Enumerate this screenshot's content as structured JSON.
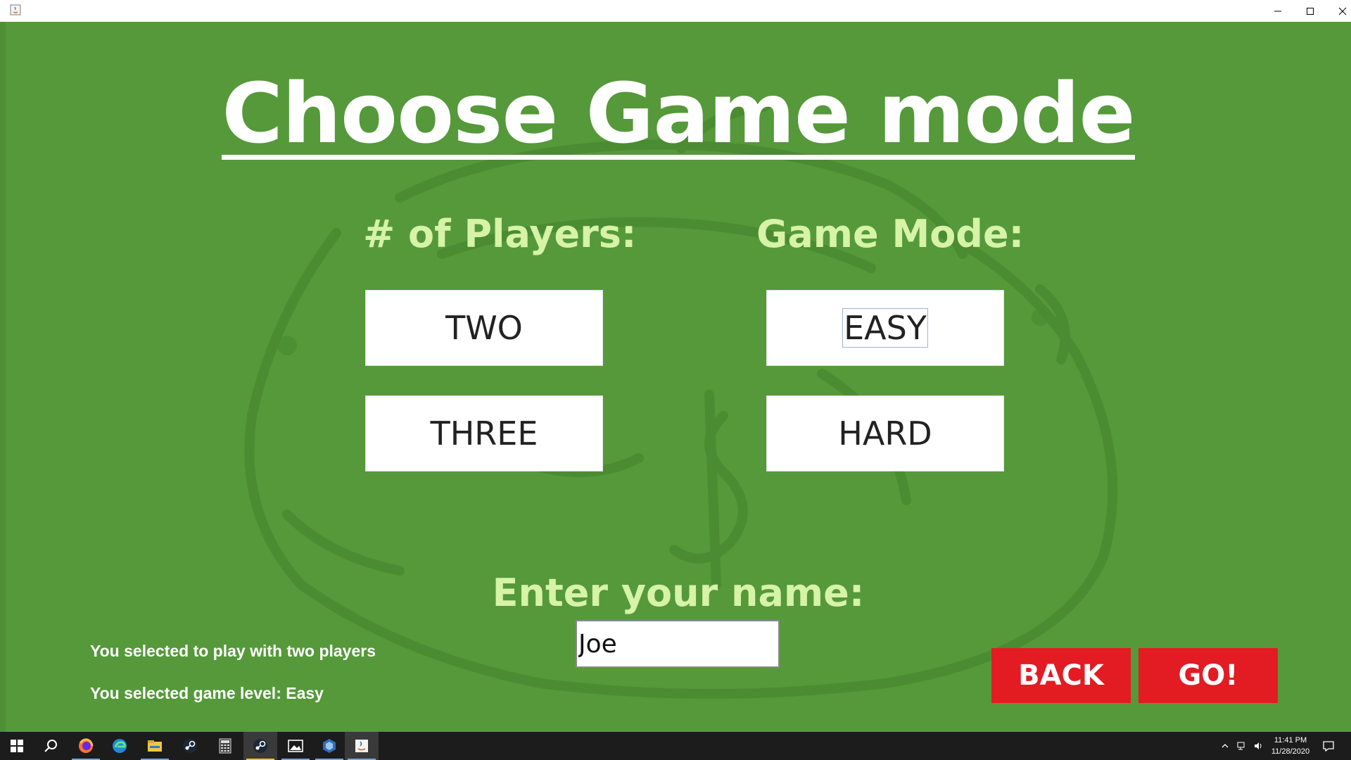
{
  "window": {
    "title": "",
    "controls": [
      "minimize-icon",
      "maximize-icon",
      "close-icon"
    ]
  },
  "screen": {
    "title": "Choose Game mode",
    "players_heading": "# of Players:",
    "mode_heading": "Game Mode:",
    "players_options": [
      {
        "label": "TWO"
      },
      {
        "label": "THREE"
      }
    ],
    "mode_options": [
      {
        "label": "EASY",
        "focused": true
      },
      {
        "label": "HARD"
      }
    ],
    "name_heading": "Enter your name:",
    "name_input": {
      "value": "Joe"
    },
    "status_players": "You selected to play with two players",
    "status_level": "You selected game level: Easy",
    "back_label": "BACK",
    "go_label": "GO!"
  },
  "taskbar": {
    "items": [
      "windows-start-icon",
      "search-icon",
      "firefox-icon",
      "edge-icon",
      "file-explorer-icon",
      "steam-icon",
      "calculator-icon",
      "steam-active-icon",
      "photos-icon",
      "virtualbox-icon",
      "java-app-icon"
    ],
    "time": "11:41 PM",
    "date": "11/28/2020"
  },
  "colors": {
    "background": "#55993a",
    "heading": "#d6f3a7",
    "action_button": "#e31b23"
  }
}
